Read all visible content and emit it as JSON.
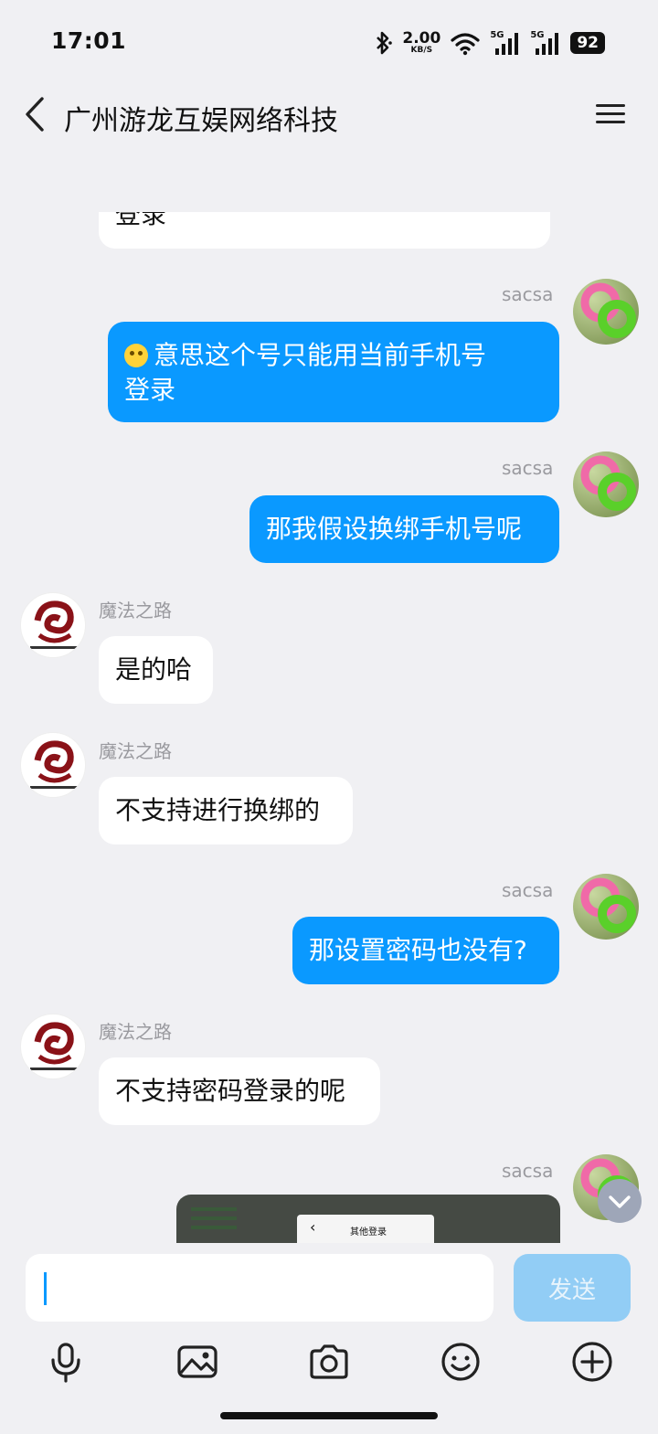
{
  "status_bar": {
    "time": "17:01",
    "net_speed": "2.00",
    "net_unit": "KB/S",
    "signal_1": "5G",
    "signal_2": "5G",
    "battery": "92"
  },
  "header": {
    "title": "广州游龙互娱网络科技"
  },
  "messages": [
    {
      "from": "them",
      "text": "登录"
    },
    {
      "from": "me",
      "name": "sacsa",
      "text": "意思这个号只能用当前手机号登录",
      "line1": "意思这个号只能用当前手机号",
      "line2": "登录"
    },
    {
      "from": "me",
      "name": "sacsa",
      "text": "那我假设换绑手机号呢"
    },
    {
      "from": "them",
      "name": "魔法之路",
      "text": "是的哈"
    },
    {
      "from": "them",
      "name": "魔法之路",
      "text": "不支持进行换绑的"
    },
    {
      "from": "me",
      "name": "sacsa",
      "text": "那设置密码也没有?"
    },
    {
      "from": "them",
      "name": "魔法之路",
      "text": "不支持密码登录的呢"
    },
    {
      "from": "me",
      "name": "sacsa",
      "image": {
        "caption": "其他登录"
      }
    }
  ],
  "input": {
    "value": "",
    "send_label": "发送"
  },
  "toolbar": [
    "mic-icon",
    "image-icon",
    "camera-icon",
    "emoji-icon",
    "plus-icon"
  ],
  "colors": {
    "outgoing": "#0a99ff",
    "incoming": "#ffffff",
    "background": "#f0f0f3",
    "send_disabled": "#92cdf5"
  }
}
